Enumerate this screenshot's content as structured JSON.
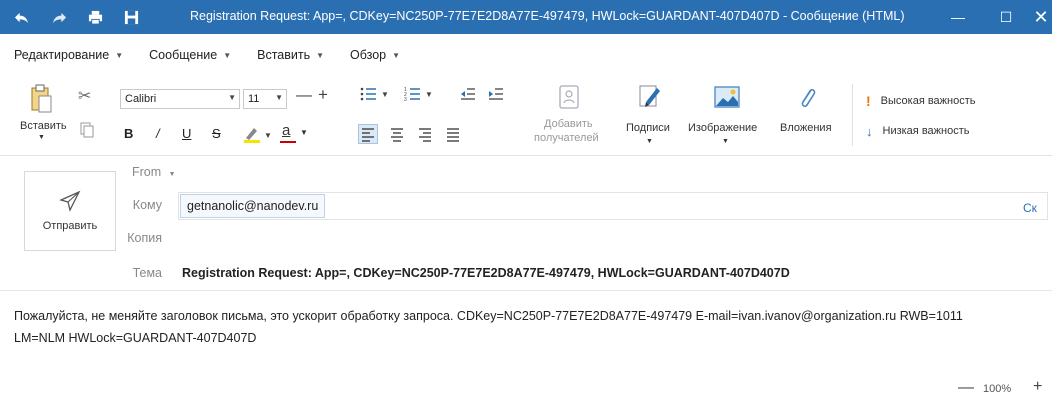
{
  "window": {
    "title": "Registration Request: App=, CDKey=NC250P-77E7E2D8A77E-497479, HWLock=GUARDANT-407D407D - Сообщение (HTML)"
  },
  "menu": {
    "items": [
      "Редактирование",
      "Сообщение",
      "Вставить",
      "Обзор"
    ]
  },
  "ribbon": {
    "paste_label": "Вставить",
    "font_name": "Calibri",
    "font_size": "11",
    "bold": "B",
    "italic": "/",
    "underline": "U",
    "strike": "S",
    "font_color_letter": "a",
    "add_recipients_line1": "Добавить",
    "add_recipients_line2": "получателей",
    "signatures_label": "Подписи",
    "image_label": "Изображение",
    "attachments_label": "Вложения",
    "high_importance_label": "Высокая важность",
    "low_importance_label": "Низкая важность"
  },
  "header": {
    "send_label": "Отправить",
    "from_label": "From",
    "to_label": "Кому",
    "to_value": "getnanolic@nanodev.ru",
    "cc_label": "Копия",
    "bcc_link": "Ск",
    "subject_label": "Тема",
    "subject_value": "Registration Request: App=, CDKey=NC250P-77E7E2D8A77E-497479, HWLock=GUARDANT-407D407D"
  },
  "body": {
    "line1": "Пожалуйста, не меняйте заголовок письма, это ускорит обработку запроса. CDKey=NC250P-77E7E2D8A77E-497479 E-mail=ivan.ivanov@organization.ru RWB=1011",
    "line2": "LM=NLM HWLock=GUARDANT-407D407D"
  },
  "status": {
    "zoom": "100%"
  },
  "colors": {
    "titlebar": "#2b6fb3",
    "accent": "#2b6fb3",
    "high_importance": "#e8730c"
  }
}
